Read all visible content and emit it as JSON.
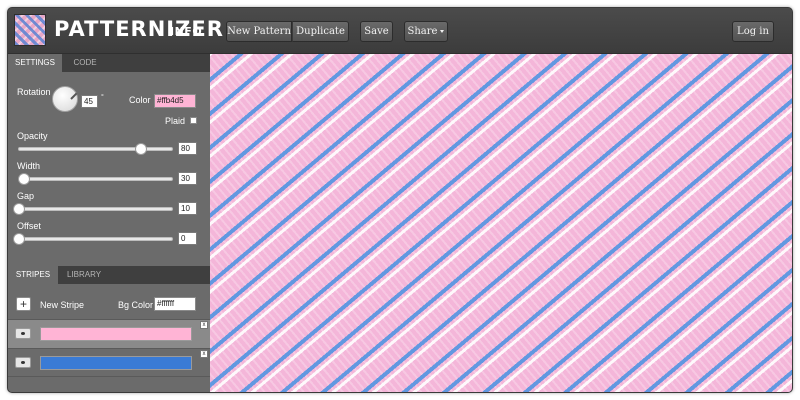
{
  "header": {
    "app_name": "PATTERNIZER",
    "info_label": "INFO",
    "buttons": {
      "new_pattern": "New Pattern",
      "duplicate": "Duplicate",
      "save": "Save",
      "share": "Share",
      "login": "Log in"
    }
  },
  "settings": {
    "tabs": [
      "SETTINGS",
      "CODE"
    ],
    "rotation": {
      "label": "Rotation",
      "value": "45",
      "unit": "°"
    },
    "color": {
      "label": "Color",
      "value": "#ffb4d5"
    },
    "plaid": {
      "label": "Plaid",
      "checked": false
    },
    "sliders": [
      {
        "label": "Opacity",
        "value": "80",
        "fraction": 0.8
      },
      {
        "label": "Width",
        "value": "30",
        "fraction": 0.03
      },
      {
        "label": "Gap",
        "value": "10",
        "fraction": 0.0
      },
      {
        "label": "Offset",
        "value": "0",
        "fraction": 0.0
      }
    ]
  },
  "stripes": {
    "tabs": [
      "STRIPES",
      "LIBRARY"
    ],
    "new_stripe_label": "New Stripe",
    "bg_color": {
      "label": "Bg Color",
      "value": "#ffffff"
    },
    "items": [
      {
        "color": "#ffb4d5",
        "selected": true,
        "remove": "x"
      },
      {
        "color": "#3a7bd5",
        "selected": false,
        "remove": "x"
      }
    ]
  },
  "colors": {
    "pattern_pink": "#f4b6d9",
    "pattern_blue": "#5a96e1",
    "panel": "#6b6b6b"
  }
}
